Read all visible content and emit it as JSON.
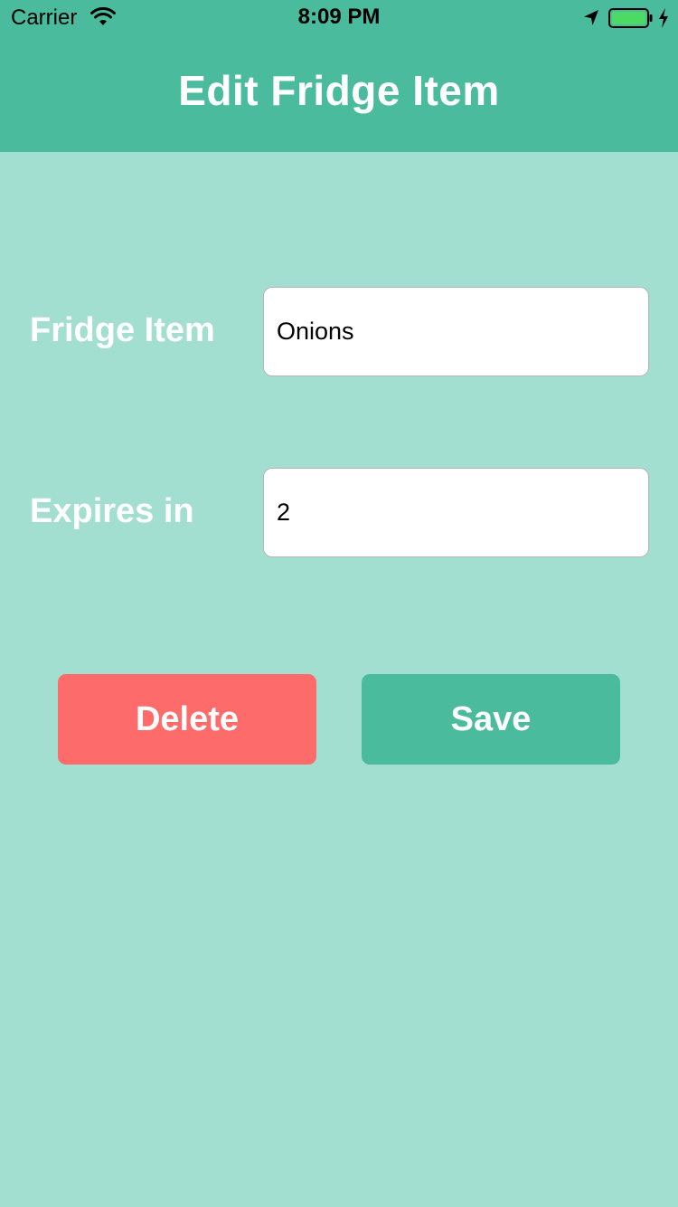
{
  "status_bar": {
    "carrier": "Carrier",
    "time": "8:09 PM",
    "icons": [
      "wifi-icon",
      "location-icon",
      "battery-icon",
      "charging-icon"
    ],
    "battery_level": 1.0
  },
  "header": {
    "title": "Edit Fridge Item"
  },
  "form": {
    "item_label": "Fridge Item",
    "item_value": "Onions",
    "expires_label": "Expires in",
    "expires_value": "2"
  },
  "actions": {
    "delete_label": "Delete",
    "save_label": "Save"
  },
  "colors": {
    "header": "#4bbb9e",
    "background": "#a3dfd0",
    "delete": "#fe6b6b",
    "save": "#4bbb9e",
    "battery": "#4cd964"
  }
}
